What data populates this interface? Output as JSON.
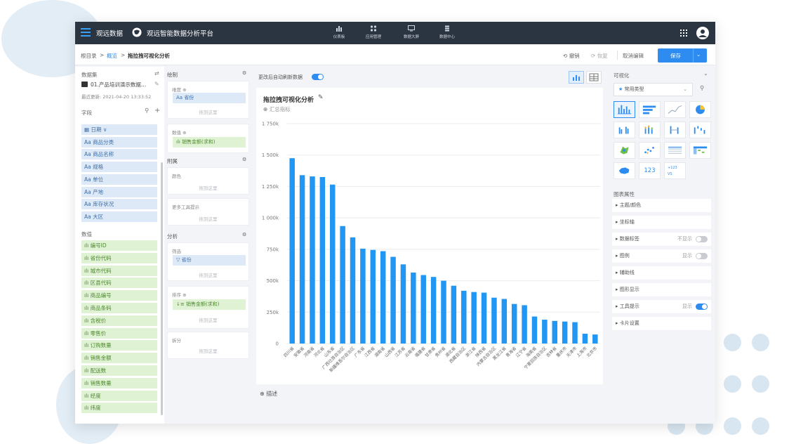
{
  "topbar": {
    "brand": "观远数据",
    "platform": "观远智能数据分析平台",
    "nav": [
      "仪表板",
      "应用管理",
      "数据大屏",
      "数据中心"
    ]
  },
  "breadcrumb": {
    "root": "根目录",
    "overview": "概览",
    "current": "拖拉拽可视化分析"
  },
  "toolbar": {
    "undo": "撤销",
    "redo": "恢复",
    "cancel_edit": "取消编辑",
    "save": "保存"
  },
  "dataset": {
    "title": "数据集",
    "name": "01.产品培训演示数据…",
    "updated": "最近更新: 2021-04-20 13:33:52"
  },
  "fields": {
    "title": "字段",
    "dimensions": [
      {
        "type": "日期",
        "label": "日期 ∨"
      },
      {
        "type": "Aa",
        "label": "商品分类"
      },
      {
        "type": "Aa",
        "label": "商品名称"
      },
      {
        "type": "Aa",
        "label": "规格"
      },
      {
        "type": "Aa",
        "label": "单位"
      },
      {
        "type": "Aa",
        "label": "产地"
      },
      {
        "type": "Aa",
        "label": "库存状况"
      },
      {
        "type": "Aa",
        "label": "大区"
      }
    ],
    "measures_title": "数值",
    "measures": [
      "编号ID",
      "省份代码",
      "城市代码",
      "区县代码",
      "商品编号",
      "商品条码",
      "含税价",
      "零售价",
      "订购数量",
      "销售金额",
      "配送数",
      "销售数量",
      "经度",
      "纬度"
    ]
  },
  "drawing": {
    "title": "绘制",
    "dim_label": "维度",
    "dim_pill": "省份",
    "val_label": "数值",
    "val_pill": "销售金额(求和)",
    "placeholder": "拖到这里",
    "attach_title": "附属",
    "color_label": "颜色",
    "tooltip_label": "更多工具提示",
    "analysis_title": "分析",
    "filter_label": "筛选",
    "filter_pill": "省份",
    "sort_label": "排序",
    "sort_pill": "销售金额(求和)",
    "split_label": "拆分"
  },
  "canvas": {
    "auto_refresh": "更改后自动刷新数据",
    "chart_title": "拖拉拽可视化分析",
    "summary": "汇总指标",
    "describe": "描述"
  },
  "chart_data": {
    "type": "bar",
    "title": "拖拉拽可视化分析",
    "xlabel": "",
    "ylabel": "",
    "ylim": [
      0,
      1750000
    ],
    "yticks": [
      "0",
      "250k",
      "500k",
      "750k",
      "1 000k",
      "1 250k",
      "1 500k",
      "1 750k"
    ],
    "categories": [
      "四川省",
      "安徽省",
      "河南省",
      "河北省",
      "山东省",
      "广西壮族自治区",
      "新疆维吾尔自治区",
      "广东省",
      "江西省",
      "湖南省",
      "山西省",
      "江苏省",
      "云南省",
      "福建省",
      "甘肃省",
      "贵州省",
      "湖北省",
      "西藏自治区",
      "浙江省",
      "陕西省",
      "内蒙古自治区",
      "黑龙江省",
      "青海省",
      "辽宁省",
      "海南省",
      "宁夏回族自治区",
      "吉林省",
      "重庆市",
      "天津市",
      "上海市",
      "北京市"
    ],
    "values": [
      1475000,
      1340000,
      1330000,
      1325000,
      1265000,
      935000,
      845000,
      755000,
      745000,
      735000,
      690000,
      630000,
      565000,
      545000,
      530000,
      500000,
      460000,
      420000,
      410000,
      405000,
      365000,
      355000,
      315000,
      305000,
      215000,
      190000,
      180000,
      175000,
      170000,
      78000,
      72000
    ],
    "bar_color": "#2196f3",
    "grid": true,
    "legend": "none"
  },
  "visual": {
    "title": "可视化",
    "type_select": "常用类型",
    "props_title": "图表属性",
    "props": [
      {
        "label": "主题/颜色"
      },
      {
        "label": "坐标轴"
      },
      {
        "label": "数据标签",
        "value": "不显示",
        "toggle": "off"
      },
      {
        "label": "图例",
        "value": "显示",
        "toggle": "off"
      },
      {
        "label": "辅助线"
      },
      {
        "label": "图形显示"
      },
      {
        "label": "工具提示",
        "value": "显示",
        "toggle": "on"
      },
      {
        "label": "卡片设置"
      }
    ],
    "kpi_icon_text": "123",
    "vs_icon_text": "+123 VS"
  }
}
